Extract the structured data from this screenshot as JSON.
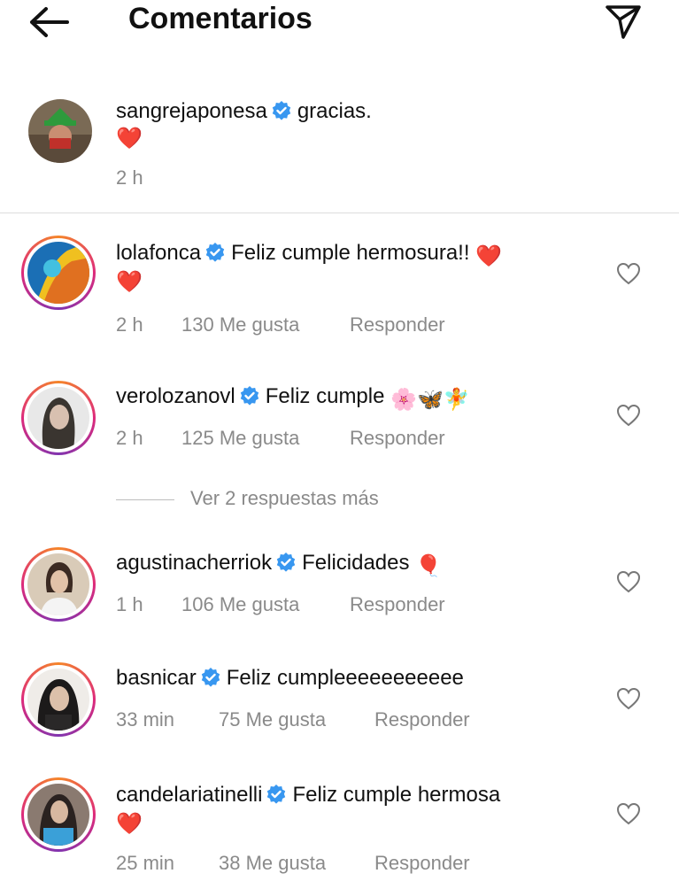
{
  "header": {
    "title": "Comentarios"
  },
  "caption": {
    "username": "sangrejaponesa",
    "text": "gracias.",
    "emoji": "❤️",
    "time": "2 h"
  },
  "comments": [
    {
      "username": "lolafonca",
      "text": "Feliz cumple hermosura!!",
      "emoji_inline": "❤️",
      "emoji_line2": "❤️",
      "time": "2 h",
      "likes": "130 Me gusta",
      "reply": "Responder"
    },
    {
      "username": "verolozanovl",
      "text": "Feliz cumple",
      "emoji_inline": "🌸🦋🧚",
      "time": "2 h",
      "likes": "125 Me gusta",
      "reply": "Responder"
    },
    {
      "username": "agustinacherriok",
      "text": "Felicidades",
      "emoji_inline": "🎈",
      "time": "1 h",
      "likes": "106 Me gusta",
      "reply": "Responder"
    },
    {
      "username": "basnicar",
      "text": "Feliz cumpleeeeeeeeeee",
      "time": "33 min",
      "likes": "75 Me gusta",
      "reply": "Responder"
    },
    {
      "username": "candelariatinelli",
      "text": "Feliz cumple hermosa",
      "emoji_line2": "❤️",
      "time": "25 min",
      "likes": "38 Me gusta",
      "reply": "Responder"
    }
  ],
  "more_replies": "Ver 2 respuestas más",
  "icons": {
    "back": "arrow-left-icon",
    "send": "paper-plane-icon",
    "verified": "verified-badge-icon",
    "like": "heart-outline-icon"
  },
  "colors": {
    "verified": "#3897f0",
    "muted": "#8a8a8a",
    "heart": "#e8202a"
  }
}
